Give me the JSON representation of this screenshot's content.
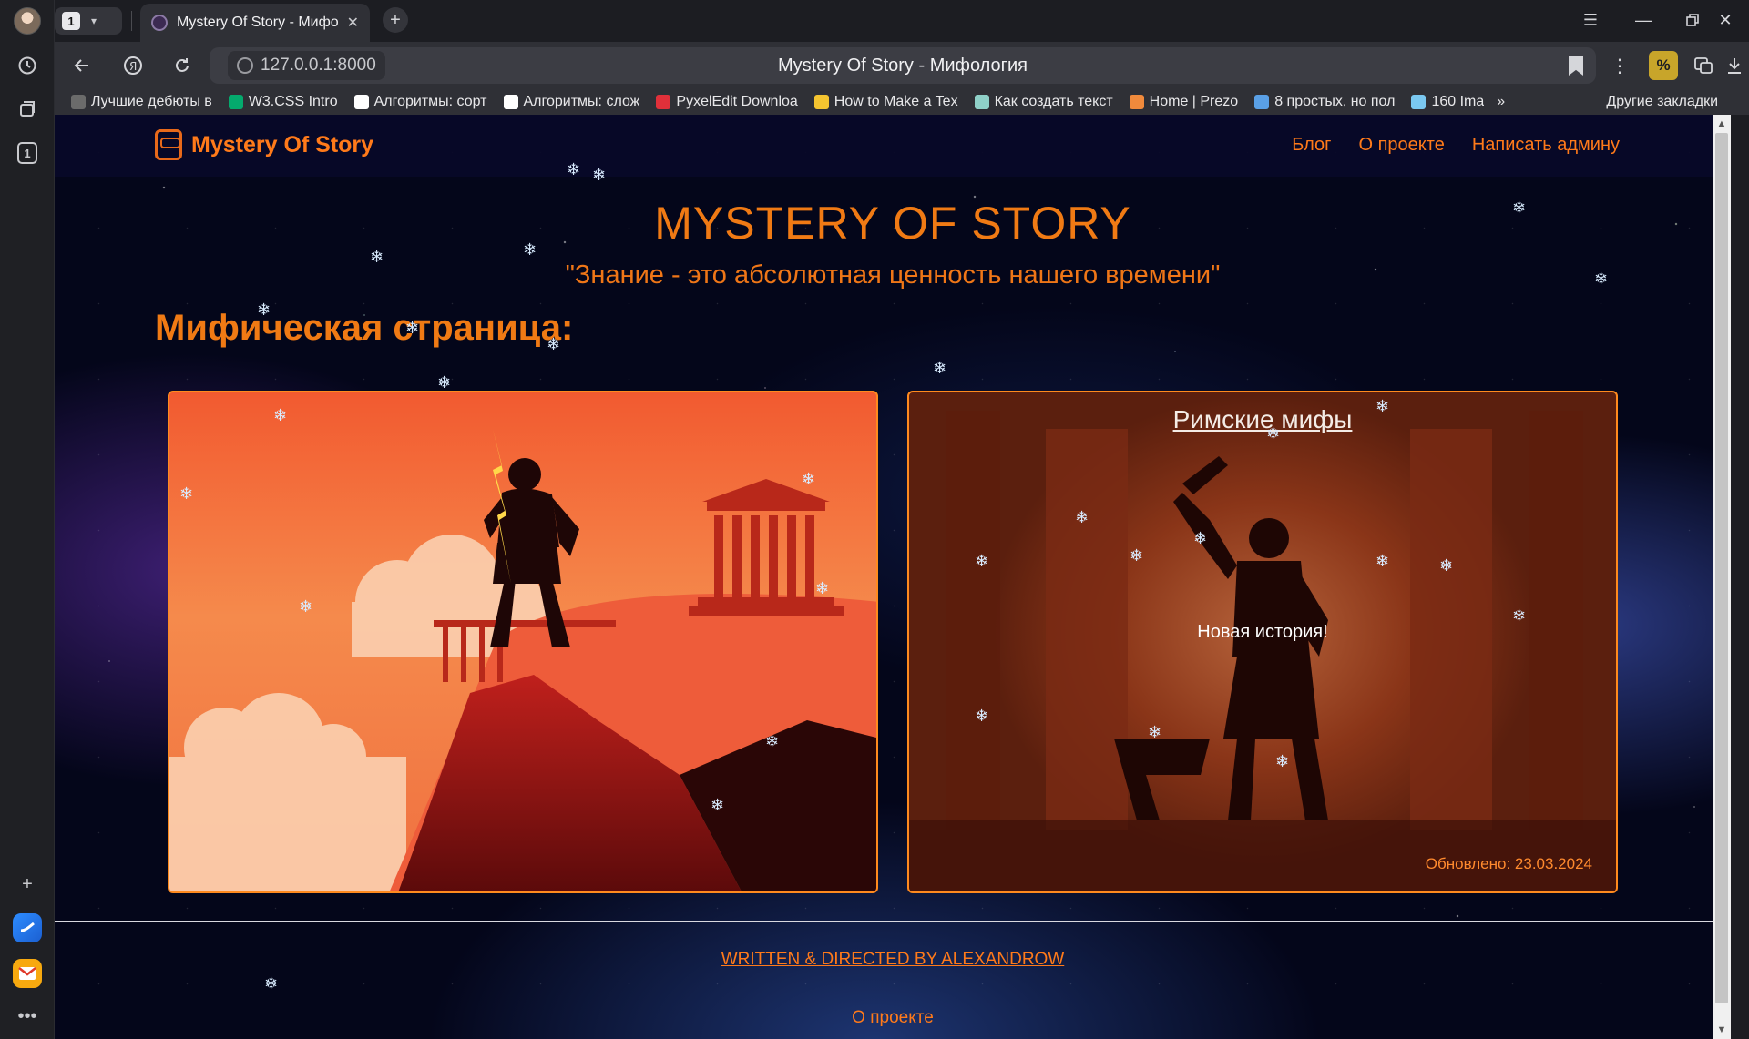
{
  "browser": {
    "tab_count": "1",
    "active_tab_title": "Mystery Of Story - Мифология",
    "address": "127.0.0.1:8000",
    "page_title": "Mystery Of Story - Мифология",
    "sidebar_badge": "1"
  },
  "bookmarks": [
    {
      "label": "Лучшие дебюты в",
      "icon": "bookmark-icon",
      "color": "#6b6b6b"
    },
    {
      "label": "W3.CSS Intro",
      "icon": "w3schools-icon",
      "color": "#04aa6d"
    },
    {
      "label": "Алгоритмы: сорт",
      "icon": "habr-icon",
      "color": "#ffffff"
    },
    {
      "label": "Алгоритмы: слож",
      "icon": "habr-icon",
      "color": "#ffffff"
    },
    {
      "label": "PyxelEdit Downloa",
      "icon": "pyxeledit-icon",
      "color": "#e0303a"
    },
    {
      "label": "How to Make a Tex",
      "icon": "python-icon",
      "color": "#f4c430"
    },
    {
      "label": "Как создать текст",
      "icon": "site-icon",
      "color": "#8fd0c8"
    },
    {
      "label": "Home | Prezo",
      "icon": "prezo-icon",
      "color": "#f08a3c"
    },
    {
      "label": "8 простых, но пол",
      "icon": "site-icon",
      "color": "#5aa0e6"
    },
    {
      "label": "160 Ima",
      "icon": "image-icon",
      "color": "#7ac8f0"
    }
  ],
  "bookmarks_more": "»",
  "bookmarks_other": "Другие закладки",
  "site": {
    "brand": "Mystery Of Story",
    "nav": [
      "Блог",
      "О проекте",
      "Написать админу"
    ],
    "hero_title": "MYSTERY OF STORY",
    "hero_quote": "\"Знание - это абсолютная ценность нашего времени\"",
    "section_title": "Мифическая страница:",
    "cards": {
      "roman": {
        "title": "Римские мифы",
        "subtitle": "Новая история!",
        "updated": "Обновлено: 23.03.2024"
      }
    },
    "footer_credit": "WRITTEN & DIRECTED BY  ALEXANDROW",
    "footer_about": "О проекте"
  },
  "colors": {
    "accent": "#ff7a1a",
    "page_bg": "#04061a",
    "browser_chrome": "#2f3036"
  }
}
